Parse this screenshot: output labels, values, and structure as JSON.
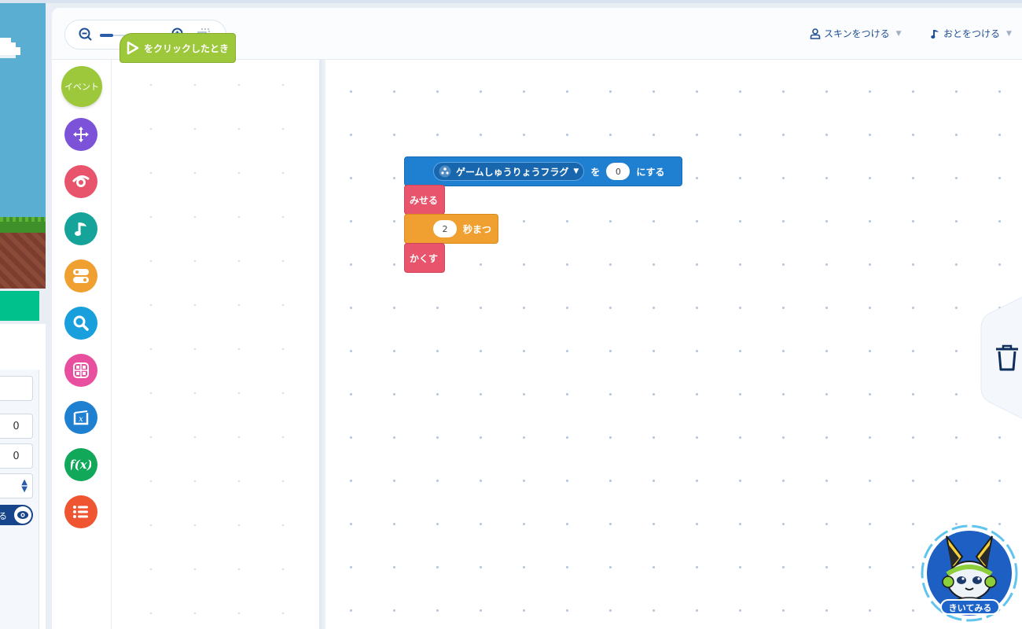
{
  "toolbar": {
    "skin_label": "スキンをつける",
    "sound_label": "おとをつける"
  },
  "zoom": {
    "level": 0.2
  },
  "categories": [
    {
      "label": "イベント",
      "icon": "event",
      "color": "#9dc83c"
    },
    {
      "label": "",
      "icon": "move-arrows-icon",
      "color": "#7b52d8"
    },
    {
      "label": "",
      "icon": "looks-eye-icon",
      "color": "#e8546c"
    },
    {
      "label": "",
      "icon": "music-note-icon",
      "color": "#16a39a"
    },
    {
      "label": "",
      "icon": "control-toggle-icon",
      "color": "#f0a030"
    },
    {
      "label": "",
      "icon": "search-icon",
      "color": "#199fdc"
    },
    {
      "label": "",
      "icon": "calculator-icon",
      "color": "#e84f9e"
    },
    {
      "label": "",
      "icon": "variable-x-icon",
      "color": "#1f7fd0"
    },
    {
      "label": "",
      "icon": "function-fx-icon",
      "color": "#12a85a"
    },
    {
      "label": "",
      "icon": "list-icon",
      "color": "#ef5530"
    }
  ],
  "flyout": {
    "when_clicked_label": "をクリックしたとき"
  },
  "blocks": {
    "set_var": {
      "var_name": "ゲームしゅうりょうフラグ",
      "to_label": "を",
      "value": "0",
      "suffix": "にする"
    },
    "show": "みせる",
    "wait": {
      "value": "2",
      "suffix": "秒まつ"
    },
    "hide": "かくす"
  },
  "left_panel": {
    "x_value": "0",
    "y_value": "0",
    "show_toggle_label": "る"
  },
  "mascot": {
    "label": "きいてみる"
  }
}
